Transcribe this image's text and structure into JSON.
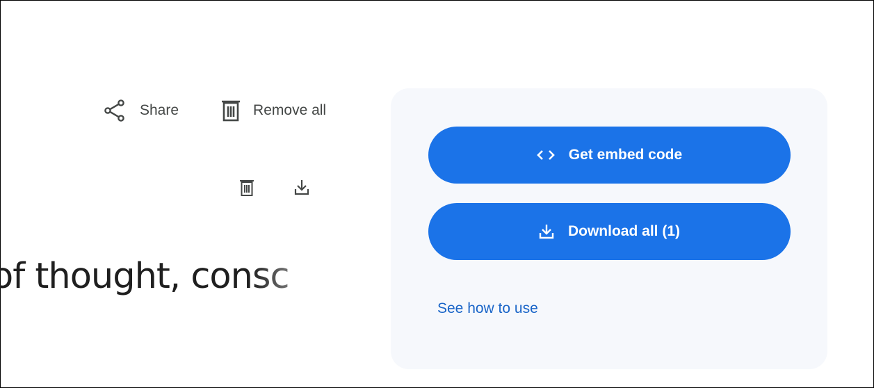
{
  "toolbar": {
    "share_label": "Share",
    "remove_all_label": "Remove all"
  },
  "preview": {
    "text": "of thought, consc"
  },
  "panel": {
    "embed_label": "Get embed code",
    "download_label": "Download all (1)",
    "help_link": "See how to use"
  },
  "colors": {
    "accent": "#1b73e8",
    "link": "#1a65c8",
    "panel_bg": "#f6f8fc",
    "icon": "#444746"
  },
  "icons": {
    "share": "share-icon",
    "remove_all": "trash-icon",
    "mini_delete": "trash-icon",
    "mini_download": "download-icon",
    "embed": "code-icon",
    "download_all": "download-icon"
  }
}
